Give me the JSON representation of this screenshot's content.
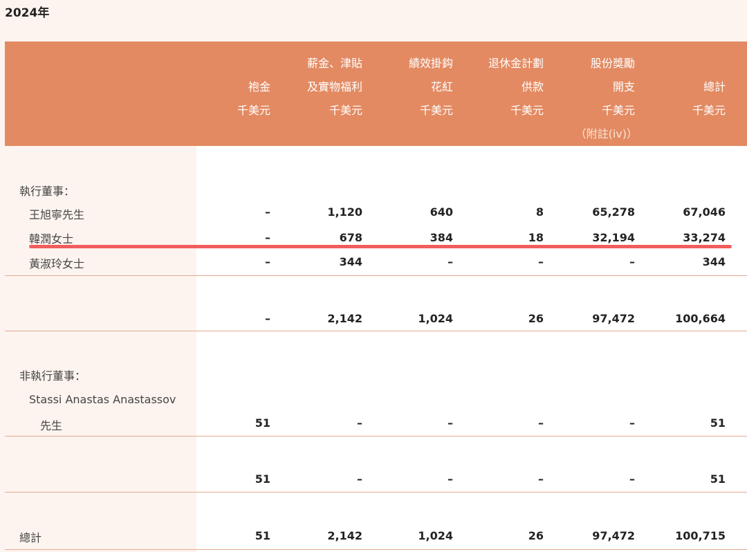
{
  "year_title": "2024年",
  "columns": [
    {
      "lines": [
        "袍金",
        "千美元"
      ]
    },
    {
      "lines": [
        "薪金、津貼",
        "及實物福利",
        "千美元"
      ]
    },
    {
      "lines": [
        "績效掛鈎",
        "花紅",
        "千美元"
      ]
    },
    {
      "lines": [
        "退休金計劃",
        "供款",
        "千美元"
      ]
    },
    {
      "lines": [
        "股份獎勵",
        "開支",
        "千美元",
        "（附註(iv)）"
      ]
    },
    {
      "lines": [
        "總計",
        "千美元"
      ]
    }
  ],
  "exec_heading": "執行董事：",
  "exec_rows": [
    {
      "name": "王旭寧先生",
      "values": [
        "–",
        "1,120",
        "640",
        "8",
        "65,278",
        "67,046"
      ]
    },
    {
      "name": "韓潤女士",
      "values": [
        "–",
        "678",
        "384",
        "18",
        "32,194",
        "33,274"
      ]
    },
    {
      "name": "黃淑玲女士",
      "values": [
        "–",
        "344",
        "–",
        "–",
        "–",
        "344"
      ]
    }
  ],
  "exec_subtotal": [
    "–",
    "2,142",
    "1,024",
    "26",
    "97,472",
    "100,664"
  ],
  "nonexec_heading": "非執行董事：",
  "nonexec_row": {
    "name_line1": "Stassi Anastas Anastassov",
    "name_line2": "先生",
    "values": [
      "51",
      "–",
      "–",
      "–",
      "–",
      "51"
    ]
  },
  "nonexec_subtotal": [
    "51",
    "–",
    "–",
    "–",
    "–",
    "51"
  ],
  "grand_total": {
    "label": "總計",
    "values": [
      "51",
      "2,142",
      "1,024",
      "26",
      "97,472",
      "100,715"
    ]
  },
  "colors": {
    "header_bg": "#e38a62",
    "highlight": "#f25d5d",
    "rule": "#e2a890"
  }
}
